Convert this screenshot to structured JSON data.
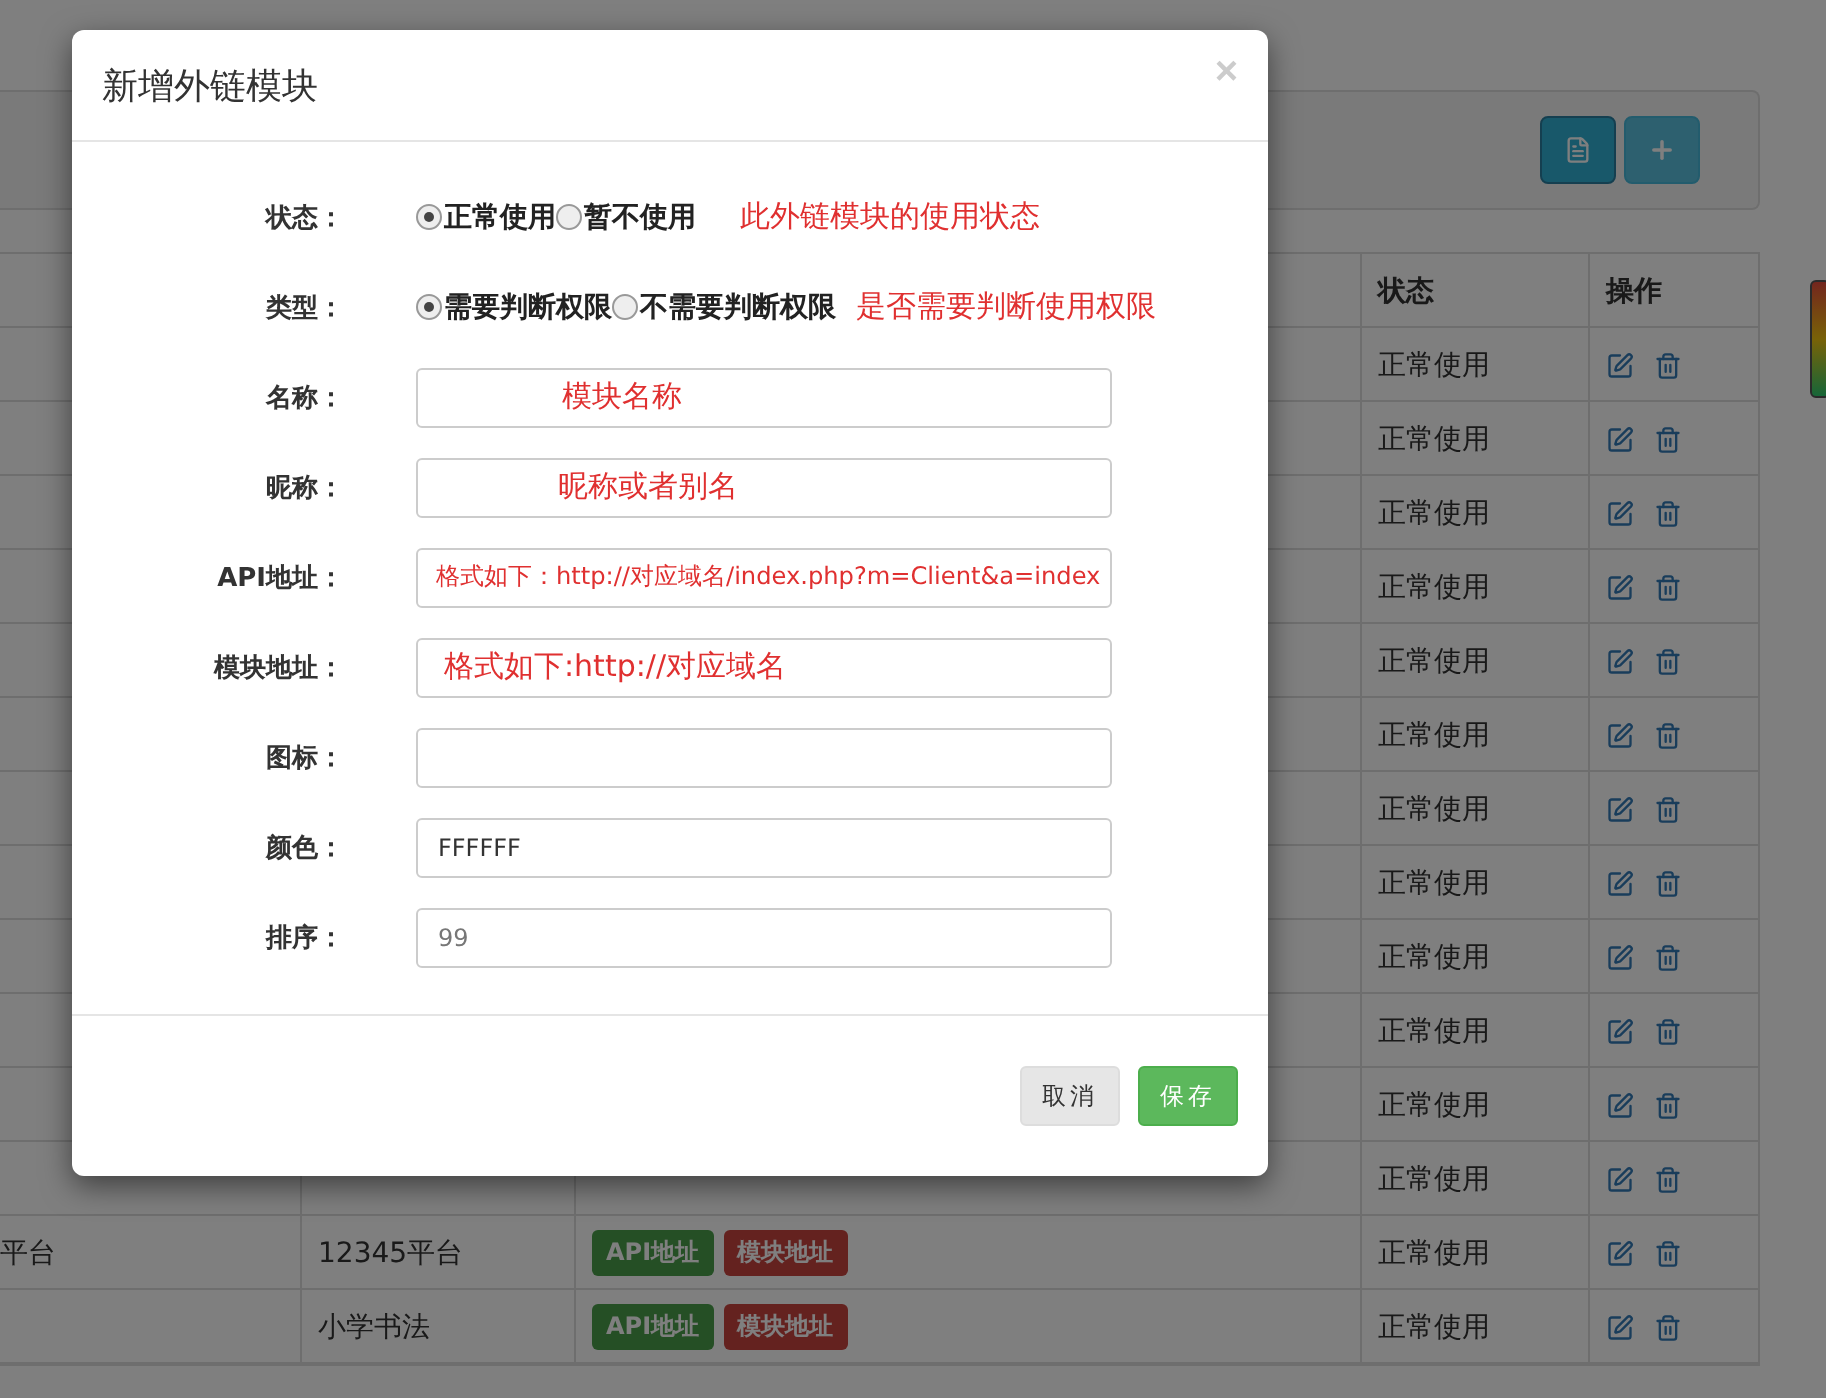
{
  "page": {
    "toolbar_buttons": [
      {
        "kind": "document"
      },
      {
        "kind": "add"
      }
    ],
    "table": {
      "columns": [
        "状态",
        "操作"
      ],
      "rows": [
        {
          "status": "正常使用"
        },
        {
          "status": "正常使用"
        },
        {
          "status": "正常使用"
        },
        {
          "status": "正常使用"
        },
        {
          "status": "正常使用"
        },
        {
          "status": "正常使用"
        },
        {
          "status": "正常使用"
        },
        {
          "status": "正常使用"
        },
        {
          "status": "正常使用"
        },
        {
          "status": "正常使用"
        },
        {
          "status": "正常使用"
        },
        {
          "status": "正常使用"
        },
        {
          "column_1": "平台",
          "column_2": "12345平台",
          "badges": [
            "API地址",
            "模块地址"
          ],
          "status": "正常使用"
        },
        {
          "column_2": "小学书法",
          "badges": [
            "API地址",
            "模块地址"
          ],
          "status": "正常使用"
        }
      ]
    }
  },
  "modal": {
    "title": "新增外链模块",
    "close": "×",
    "fields": [
      {
        "kind": "radio",
        "label": "状态：",
        "options": [
          {
            "label": "正常使用",
            "selected": true
          },
          {
            "label": "暂不使用",
            "selected": false
          }
        ],
        "note": "此外链模块的使用状态"
      },
      {
        "kind": "radio",
        "label": "类型：",
        "options": [
          {
            "label": "需要判断权限",
            "selected": true
          },
          {
            "label": "不需要判断权限",
            "selected": false
          }
        ],
        "note": "是否需要判断使用权限"
      },
      {
        "kind": "text",
        "label": "名称：",
        "note": "模块名称"
      },
      {
        "kind": "text",
        "label": "昵称：",
        "note": "昵称或者别名"
      },
      {
        "kind": "text",
        "label": "API地址：",
        "note": "格式如下：http://对应域名/index.php?m=Client&a=index"
      },
      {
        "kind": "text",
        "label": "模块地址：",
        "note": "格式如下:http://对应域名"
      },
      {
        "kind": "text",
        "label": "图标："
      },
      {
        "kind": "text",
        "label": "颜色：",
        "value": "FFFFFF"
      },
      {
        "kind": "text",
        "label": "排序：",
        "placeholder": "99"
      }
    ],
    "buttons": [
      {
        "kind": "default",
        "label": "取消"
      },
      {
        "kind": "primary",
        "label": "保存"
      }
    ]
  }
}
